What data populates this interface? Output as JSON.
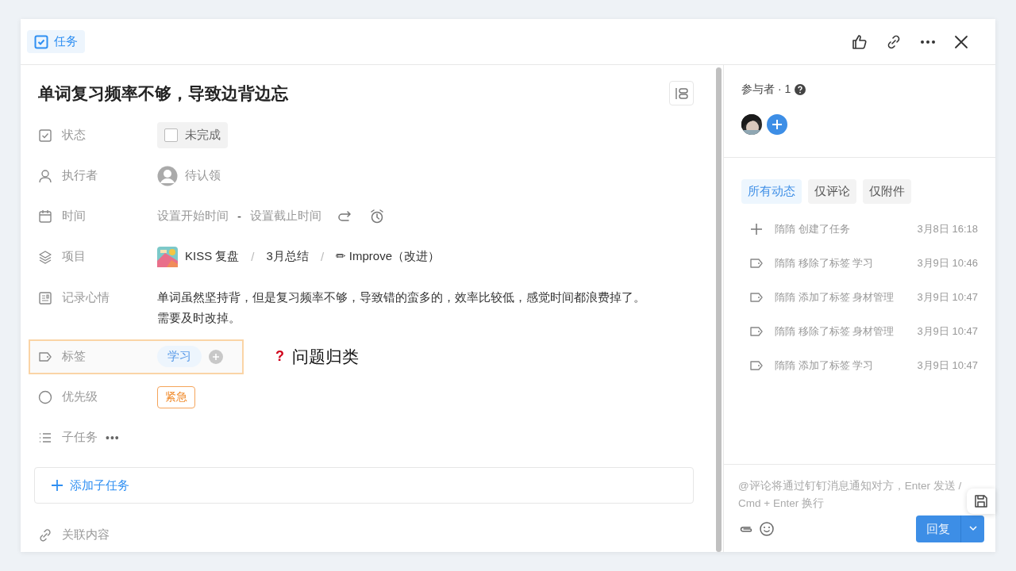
{
  "header": {
    "badge": "任务"
  },
  "task": {
    "title": "单词复习频率不够，导致边背边忘",
    "fields": [
      {
        "kind": "status",
        "label": "状态",
        "checked": false,
        "value": "未完成"
      },
      {
        "kind": "assignee",
        "label": "执行者",
        "value": "待认领"
      },
      {
        "kind": "time",
        "label": "时间",
        "start": "设置开始时间",
        "separator": "-",
        "end": "设置截止时间"
      },
      {
        "kind": "project",
        "label": "项目",
        "path": [
          "KISS 复盘",
          "3月总结",
          "✏ Improve（改进）"
        ],
        "separator": "/"
      },
      {
        "kind": "note",
        "label": "记录心情",
        "text": "单词虽然坚持背，但是复习频率不够，导致错的蛮多的，效率比较低，感觉时间都浪费掉了。需要及时改掉。"
      },
      {
        "kind": "tags",
        "label": "标签",
        "highlighted": true,
        "tags": [
          "学习"
        ],
        "annotation": {
          "mark": "?",
          "text": "问题归类"
        }
      },
      {
        "kind": "priority",
        "label": "优先级",
        "value": "紧急"
      },
      {
        "kind": "subtasks",
        "label": "子任务",
        "more": "•••"
      },
      {
        "kind": "add",
        "label": "添加子任务"
      },
      {
        "kind": "related",
        "label": "关联内容"
      }
    ]
  },
  "participants": {
    "title": "参与者 · 1"
  },
  "activity_tabs": [
    {
      "label": "所有动态",
      "selected": true
    },
    {
      "label": "仅评论",
      "selected": false
    },
    {
      "label": "仅附件",
      "selected": false
    }
  ],
  "activity": [
    {
      "kind": "create",
      "text": "隋隋 创建了任务",
      "time": "3月8日 16:18"
    },
    {
      "kind": "tag",
      "text": "隋隋 移除了标签 学习",
      "time": "3月9日 10:46"
    },
    {
      "kind": "tag",
      "text": "隋隋 添加了标签 身材管理",
      "time": "3月9日 10:47"
    },
    {
      "kind": "tag",
      "text": "隋隋 移除了标签 身材管理",
      "time": "3月9日 10:47"
    },
    {
      "kind": "tag",
      "text": "隋隋 添加了标签 学习",
      "time": "3月9日 10:47"
    }
  ],
  "comment": {
    "placeholder": "@评论将通过钉钉消息通知对方，Enter 发送 / Cmd + Enter 换行",
    "reply": "回复"
  }
}
